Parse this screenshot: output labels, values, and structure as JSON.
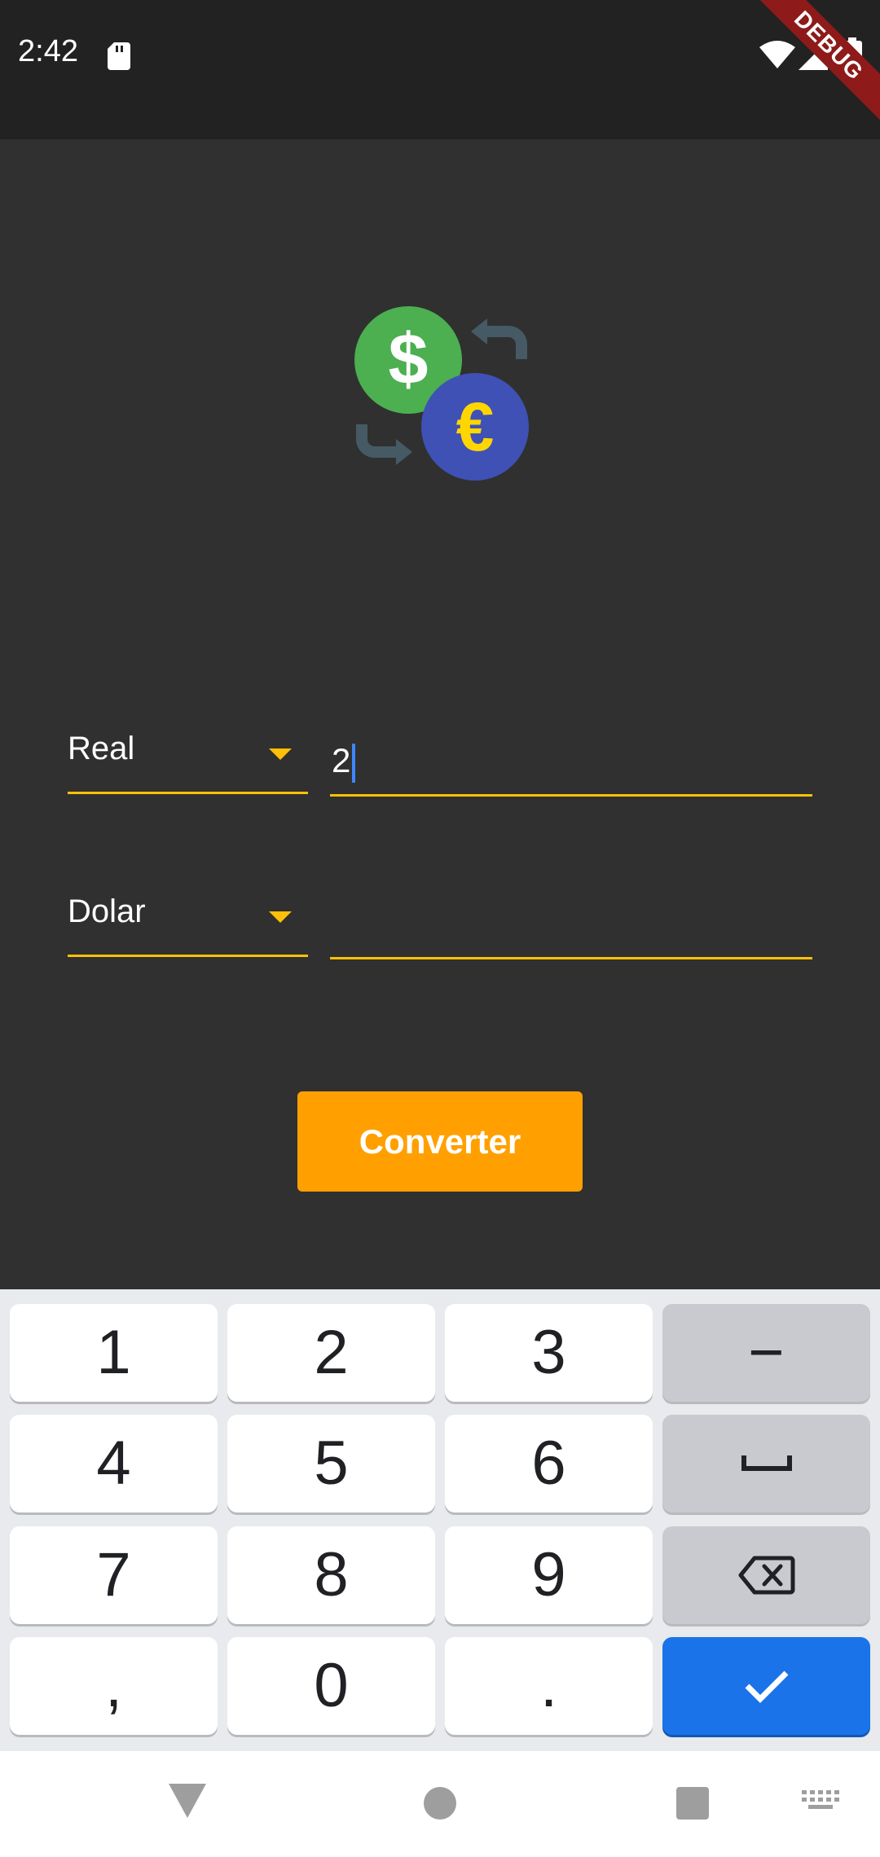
{
  "status_bar": {
    "time": "2:42",
    "debug_label": "DEBUG"
  },
  "converter": {
    "from_currency": "Real",
    "from_amount": "2",
    "to_currency": "Dolar",
    "to_amount": "",
    "convert_label": "Converter"
  },
  "keyboard": {
    "keys": [
      "1",
      "2",
      "3",
      "−",
      "4",
      "5",
      "6",
      "space",
      "7",
      "8",
      "9",
      "backspace",
      ",",
      "0",
      ".",
      "done"
    ],
    "k1": "1",
    "k2": "2",
    "k3": "3",
    "k_minus": "−",
    "k4": "4",
    "k5": "5",
    "k6": "6",
    "k7": "7",
    "k8": "8",
    "k9": "9",
    "k_comma": ",",
    "k0": "0",
    "k_dot": "."
  },
  "colors": {
    "background": "#303030",
    "status_bar": "#222222",
    "accent": "#ffc107",
    "button": "#ffa000",
    "keyboard_action": "#1a73e8"
  },
  "icons": [
    "sd-card-icon",
    "wifi-icon",
    "signal-icon",
    "battery-icon",
    "currency-exchange-icon",
    "dropdown-arrow-icon",
    "backspace-icon",
    "space-icon",
    "check-icon",
    "nav-back-icon",
    "nav-home-icon",
    "nav-recent-icon",
    "keyboard-icon"
  ]
}
